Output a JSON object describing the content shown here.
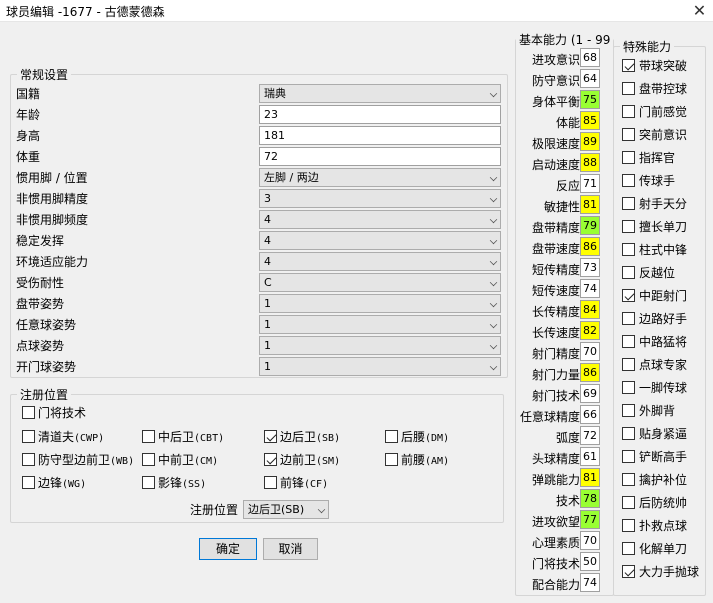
{
  "window": {
    "title": "球员编辑 -1677 - 古德蒙德森",
    "close_glyph": "✕"
  },
  "general": {
    "legend": "常规设置",
    "rows": [
      {
        "label": "国籍",
        "value": "瑞典",
        "type": "dropdown"
      },
      {
        "label": "年龄",
        "value": "23",
        "type": "text"
      },
      {
        "label": "身高",
        "value": "181",
        "type": "text"
      },
      {
        "label": "体重",
        "value": "72",
        "type": "text"
      },
      {
        "label": "惯用脚 / 位置",
        "value": "左脚 / 两边",
        "type": "dropdown"
      },
      {
        "label": "非惯用脚精度",
        "value": "3",
        "type": "dropdown"
      },
      {
        "label": "非惯用脚频度",
        "value": "4",
        "type": "dropdown"
      },
      {
        "label": "稳定发挥",
        "value": "4",
        "type": "dropdown"
      },
      {
        "label": "环境适应能力",
        "value": "4",
        "type": "dropdown"
      },
      {
        "label": "受伤耐性",
        "value": "C",
        "type": "dropdown"
      },
      {
        "label": "盘带姿势",
        "value": "1",
        "type": "dropdown"
      },
      {
        "label": "任意球姿势",
        "value": "1",
        "type": "dropdown"
      },
      {
        "label": "点球姿势",
        "value": "1",
        "type": "dropdown"
      },
      {
        "label": "开门球姿势",
        "value": "1",
        "type": "dropdown"
      }
    ]
  },
  "positions": {
    "legend": "注册位置",
    "gk": {
      "label": "门将技术",
      "checked": false
    },
    "items": [
      {
        "label": "清道夫",
        "code": "(CWP)",
        "checked": false
      },
      {
        "label": "中后卫",
        "code": "(CBT)",
        "checked": false
      },
      {
        "label": "边后卫",
        "code": "(SB)",
        "checked": true
      },
      {
        "label": "后腰",
        "code": "(DM)",
        "checked": false
      },
      {
        "label": "防守型边前卫",
        "code": "(WB)",
        "checked": false
      },
      {
        "label": "中前卫",
        "code": "(CM)",
        "checked": false
      },
      {
        "label": "边前卫",
        "code": "(SM)",
        "checked": true
      },
      {
        "label": "前腰",
        "code": "(AM)",
        "checked": false
      },
      {
        "label": "边锋",
        "code": "(WG)",
        "checked": false
      },
      {
        "label": "影锋",
        "code": "(SS)",
        "checked": false
      },
      {
        "label": "前锋",
        "code": "(CF)",
        "checked": false
      }
    ],
    "select_label": "注册位置",
    "select_value": "边后卫(SB)"
  },
  "buttons": {
    "ok": "确定",
    "cancel": "取消"
  },
  "abilities": {
    "legend": "基本能力 (1 - 99",
    "colors": {
      "white": "#ffffff",
      "yellow": "#ffff00",
      "green": "#99ff33"
    },
    "items": [
      {
        "label": "进攻意识",
        "value": "68",
        "color": "white"
      },
      {
        "label": "防守意识",
        "value": "64",
        "color": "white"
      },
      {
        "label": "身体平衡",
        "value": "75",
        "color": "green"
      },
      {
        "label": "体能",
        "value": "85",
        "color": "yellow"
      },
      {
        "label": "极限速度",
        "value": "89",
        "color": "yellow"
      },
      {
        "label": "启动速度",
        "value": "88",
        "color": "yellow"
      },
      {
        "label": "反应",
        "value": "71",
        "color": "white"
      },
      {
        "label": "敏捷性",
        "value": "81",
        "color": "yellow"
      },
      {
        "label": "盘带精度",
        "value": "79",
        "color": "green"
      },
      {
        "label": "盘带速度",
        "value": "86",
        "color": "yellow"
      },
      {
        "label": "短传精度",
        "value": "73",
        "color": "white"
      },
      {
        "label": "短传速度",
        "value": "74",
        "color": "white"
      },
      {
        "label": "长传精度",
        "value": "84",
        "color": "yellow"
      },
      {
        "label": "长传速度",
        "value": "82",
        "color": "yellow"
      },
      {
        "label": "射门精度",
        "value": "70",
        "color": "white"
      },
      {
        "label": "射门力量",
        "value": "86",
        "color": "yellow"
      },
      {
        "label": "射门技术",
        "value": "69",
        "color": "white"
      },
      {
        "label": "任意球精度",
        "value": "66",
        "color": "white"
      },
      {
        "label": "弧度",
        "value": "72",
        "color": "white"
      },
      {
        "label": "头球精度",
        "value": "61",
        "color": "white"
      },
      {
        "label": "弹跳能力",
        "value": "81",
        "color": "yellow"
      },
      {
        "label": "技术",
        "value": "78",
        "color": "green"
      },
      {
        "label": "进攻欲望",
        "value": "77",
        "color": "green"
      },
      {
        "label": "心理素质",
        "value": "70",
        "color": "white"
      },
      {
        "label": "门将技术",
        "value": "50",
        "color": "white"
      },
      {
        "label": "配合能力",
        "value": "74",
        "color": "white"
      }
    ]
  },
  "special": {
    "legend": "特殊能力",
    "items": [
      {
        "label": "带球突破",
        "checked": true
      },
      {
        "label": "盘带控球",
        "checked": false
      },
      {
        "label": "门前感觉",
        "checked": false
      },
      {
        "label": "突前意识",
        "checked": false
      },
      {
        "label": "指挥官",
        "checked": false
      },
      {
        "label": "传球手",
        "checked": false
      },
      {
        "label": "射手天分",
        "checked": false
      },
      {
        "label": "擅长单刀",
        "checked": false
      },
      {
        "label": "柱式中锋",
        "checked": false
      },
      {
        "label": "反越位",
        "checked": false
      },
      {
        "label": "中距射门",
        "checked": true
      },
      {
        "label": "边路好手",
        "checked": false
      },
      {
        "label": "中路猛将",
        "checked": false
      },
      {
        "label": "点球专家",
        "checked": false
      },
      {
        "label": "一脚传球",
        "checked": false
      },
      {
        "label": "外脚背",
        "checked": false
      },
      {
        "label": "贴身紧逼",
        "checked": false
      },
      {
        "label": "铲断高手",
        "checked": false
      },
      {
        "label": "擒护补位",
        "checked": false
      },
      {
        "label": "后防统帅",
        "checked": false
      },
      {
        "label": "扑救点球",
        "checked": false
      },
      {
        "label": "化解单刀",
        "checked": false
      },
      {
        "label": "大力手抛球",
        "checked": true
      }
    ]
  }
}
